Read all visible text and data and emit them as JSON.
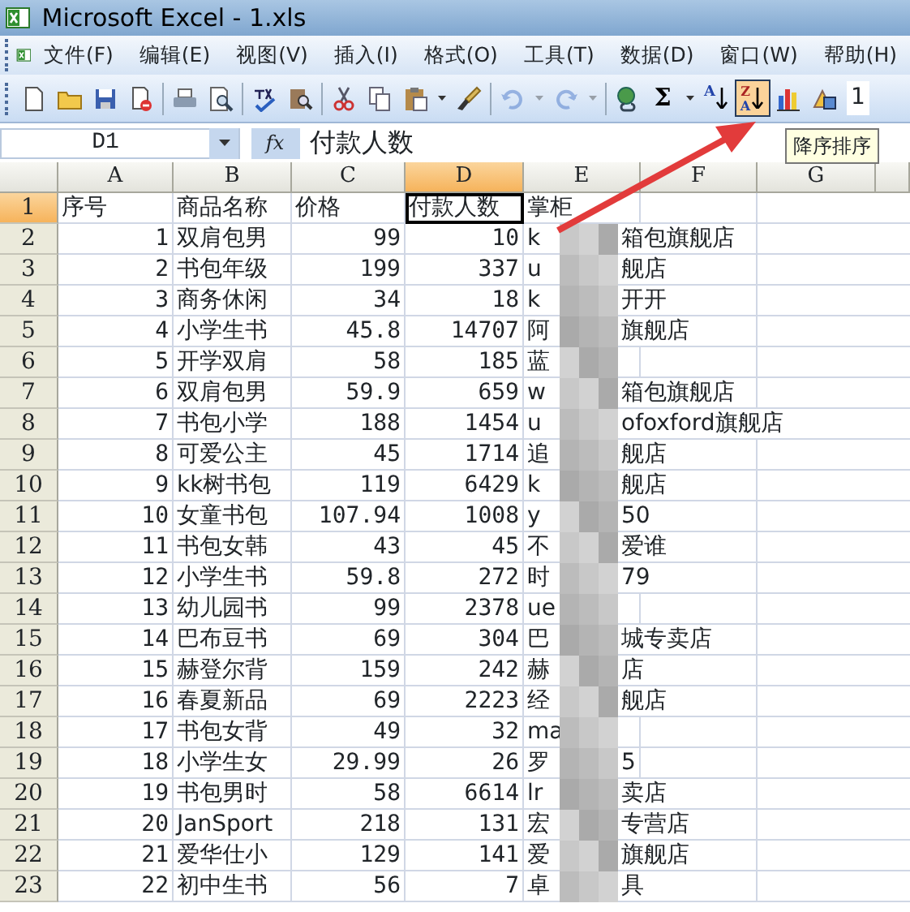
{
  "window": {
    "title": "Microsoft Excel - 1.xls"
  },
  "menu": [
    "文件(F)",
    "编辑(E)",
    "视图(V)",
    "插入(I)",
    "格式(O)",
    "工具(T)",
    "数据(D)",
    "窗口(W)",
    "帮助(H)"
  ],
  "toolbar": [
    {
      "kind": "new"
    },
    {
      "kind": "open"
    },
    {
      "kind": "save"
    },
    {
      "kind": "permission"
    },
    {
      "kind": "separator"
    },
    {
      "kind": "print"
    },
    {
      "kind": "preview"
    },
    {
      "kind": "separator"
    },
    {
      "kind": "spelling"
    },
    {
      "kind": "research"
    },
    {
      "kind": "separator"
    },
    {
      "kind": "cut"
    },
    {
      "kind": "copy"
    },
    {
      "kind": "paste",
      "dropdown": true
    },
    {
      "kind": "painter"
    },
    {
      "kind": "separator"
    },
    {
      "kind": "undo",
      "dropdown": true,
      "disabled": true
    },
    {
      "kind": "redo",
      "dropdown": true,
      "disabled": true
    },
    {
      "kind": "separator"
    },
    {
      "kind": "hyperlink"
    },
    {
      "kind": "sum",
      "glyph": "Σ",
      "dropdown": true
    },
    {
      "kind": "sort-ascending",
      "glyph": "A"
    },
    {
      "kind": "sort-descending",
      "glyph": "ZA",
      "pressed": true
    },
    {
      "kind": "chart"
    },
    {
      "kind": "drawing"
    },
    {
      "kind": "font-size",
      "text": "1"
    }
  ],
  "tooltip": "降序排序",
  "formula_bar": {
    "name_box": "D1",
    "function_label": "fx",
    "formula": "付款人数"
  },
  "columns": [
    {
      "label": "A",
      "selected": false
    },
    {
      "label": "B",
      "selected": false
    },
    {
      "label": "C",
      "selected": false
    },
    {
      "label": "D",
      "selected": true
    },
    {
      "label": "E",
      "selected": false
    },
    {
      "label": "F",
      "selected": false
    },
    {
      "label": "G",
      "selected": false
    }
  ],
  "rows": [
    {
      "number": "1",
      "selected": true,
      "cells": [
        "序号",
        "商品名称",
        "价格",
        "付款人数"
      ],
      "shop": {
        "start": "掌柜"
      }
    },
    {
      "number": "2",
      "selected": false,
      "cells": [
        "1",
        "双肩包男",
        "99",
        "10"
      ],
      "shop": {
        "start": "k",
        "end": "箱包旗舰店"
      }
    },
    {
      "number": "3",
      "selected": false,
      "cells": [
        "2",
        "书包年级",
        "199",
        "337"
      ],
      "shop": {
        "start": "u",
        "end": "舰店"
      }
    },
    {
      "number": "4",
      "selected": false,
      "cells": [
        "3",
        "商务休闲",
        "34",
        "18"
      ],
      "shop": {
        "start": "k",
        "end": "开开"
      }
    },
    {
      "number": "5",
      "selected": false,
      "cells": [
        "4",
        "小学生书",
        "45.8",
        "14707"
      ],
      "shop": {
        "start": "阿",
        "end": "旗舰店"
      }
    },
    {
      "number": "6",
      "selected": false,
      "cells": [
        "5",
        "开学双肩",
        "58",
        "185"
      ],
      "shop": {
        "start": "蓝"
      }
    },
    {
      "number": "7",
      "selected": false,
      "cells": [
        "6",
        "双肩包男",
        "59.9",
        "659"
      ],
      "shop": {
        "start": "w",
        "end": "箱包旗舰店"
      }
    },
    {
      "number": "8",
      "selected": false,
      "cells": [
        "7",
        "书包小学",
        "188",
        "1454"
      ],
      "shop": {
        "start": "u",
        "end": "ofoxford旗舰店"
      }
    },
    {
      "number": "9",
      "selected": false,
      "cells": [
        "8",
        "可爱公主",
        "45",
        "1714"
      ],
      "shop": {
        "start": "追",
        "end": "舰店"
      }
    },
    {
      "number": "10",
      "selected": false,
      "cells": [
        "9",
        "kk树书包",
        "119",
        "6429"
      ],
      "shop": {
        "start": "k",
        "end": "舰店"
      }
    },
    {
      "number": "11",
      "selected": false,
      "cells": [
        "10",
        "女童书包",
        "107.94",
        "1008"
      ],
      "shop": {
        "start": "y",
        "end": "50"
      }
    },
    {
      "number": "12",
      "selected": false,
      "cells": [
        "11",
        "书包女韩",
        "43",
        "45"
      ],
      "shop": {
        "start": "不",
        "end": "爱谁"
      }
    },
    {
      "number": "13",
      "selected": false,
      "cells": [
        "12",
        "小学生书",
        "59.8",
        "272"
      ],
      "shop": {
        "start": "时",
        "end": "79"
      }
    },
    {
      "number": "14",
      "selected": false,
      "cells": [
        "13",
        "幼儿园书",
        "99",
        "2378"
      ],
      "shop": {
        "start": "ue"
      }
    },
    {
      "number": "15",
      "selected": false,
      "cells": [
        "14",
        "巴布豆书",
        "69",
        "304"
      ],
      "shop": {
        "start": "巴",
        "end": "城专卖店"
      }
    },
    {
      "number": "16",
      "selected": false,
      "cells": [
        "15",
        "赫登尔背",
        "159",
        "242"
      ],
      "shop": {
        "start": "赫",
        "end": "店"
      }
    },
    {
      "number": "17",
      "selected": false,
      "cells": [
        "16",
        "春夏新品",
        "69",
        "2223"
      ],
      "shop": {
        "start": "经",
        "end": "舰店"
      }
    },
    {
      "number": "18",
      "selected": false,
      "cells": [
        "17",
        "书包女背",
        "49",
        "32"
      ],
      "shop": {
        "start": "ma"
      }
    },
    {
      "number": "19",
      "selected": false,
      "cells": [
        "18",
        "小学生女",
        "29.99",
        "26"
      ],
      "shop": {
        "start": "罗",
        "end": "5"
      }
    },
    {
      "number": "20",
      "selected": false,
      "cells": [
        "19",
        "书包男时",
        "58",
        "6614"
      ],
      "shop": {
        "start": "lr",
        "end": "卖店"
      }
    },
    {
      "number": "21",
      "selected": false,
      "cells": [
        "20",
        "JanSport",
        "218",
        "131"
      ],
      "shop": {
        "start": "宏",
        "end": "专营店"
      }
    },
    {
      "number": "22",
      "selected": false,
      "cells": [
        "21",
        "爱华仕小",
        "129",
        "141"
      ],
      "shop": {
        "start": "爱",
        "end": "旗舰店"
      }
    },
    {
      "number": "23",
      "selected": false,
      "cells": [
        "22",
        "初中生书",
        "56",
        "7"
      ],
      "shop": {
        "start": "卓",
        "end": "具"
      }
    }
  ]
}
